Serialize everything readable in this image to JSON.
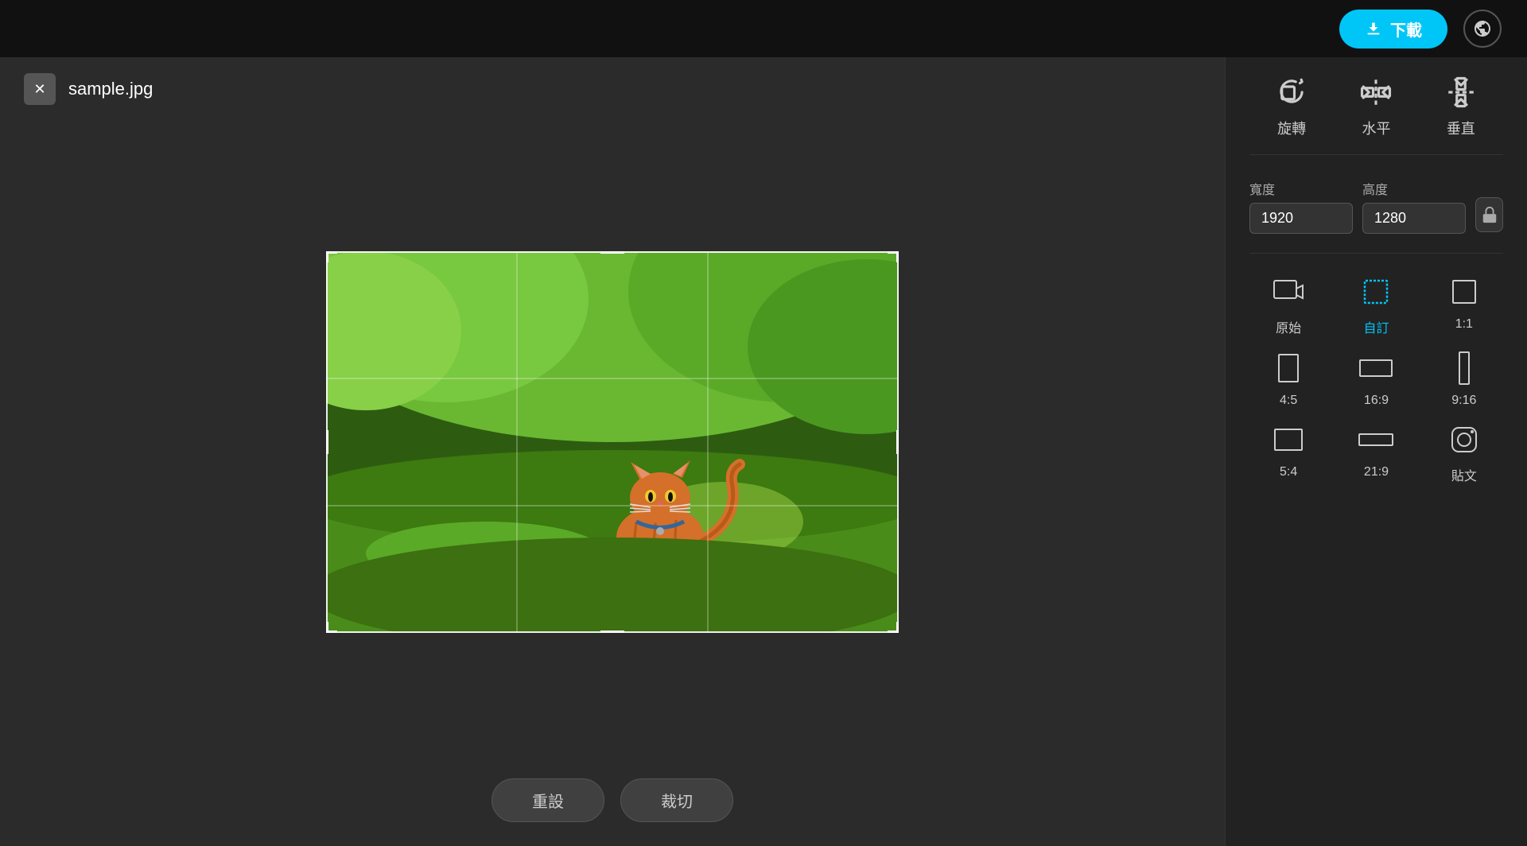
{
  "topbar": {
    "download_label": "下載",
    "download_icon": "⬇",
    "globe_icon": "🌐"
  },
  "left": {
    "close_icon": "✕",
    "filename": "sample.jpg",
    "reset_label": "重設",
    "crop_label": "裁切"
  },
  "right": {
    "rotate_label": "旋轉",
    "horizontal_label": "水平",
    "vertical_label": "垂直",
    "width_label": "寬度",
    "height_label": "高度",
    "width_value": "1920",
    "height_value": "1280",
    "lock_icon": "🔒",
    "ratios": [
      {
        "id": "original",
        "label": "原始",
        "active": false
      },
      {
        "id": "custom",
        "label": "自訂",
        "active": true
      },
      {
        "id": "1_1",
        "label": "1:1",
        "active": false
      },
      {
        "id": "4_5",
        "label": "4:5",
        "active": false
      },
      {
        "id": "16_9",
        "label": "16:9",
        "active": false
      },
      {
        "id": "9_16",
        "label": "9:16",
        "active": false
      },
      {
        "id": "5_4",
        "label": "5:4",
        "active": false
      },
      {
        "id": "21_9",
        "label": "21:9",
        "active": false
      },
      {
        "id": "post",
        "label": "貼文",
        "active": false
      }
    ]
  }
}
